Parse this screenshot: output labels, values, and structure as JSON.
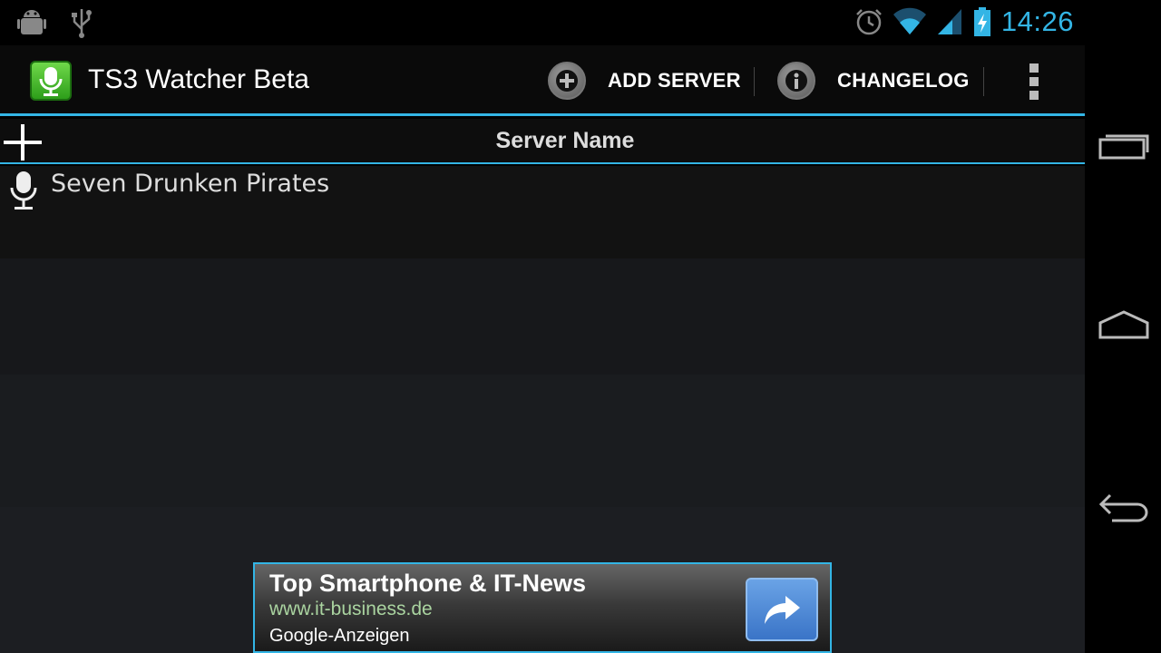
{
  "status_bar": {
    "time": "14:26",
    "left_icons": [
      "android-debug-icon",
      "usb-icon"
    ],
    "right_icons": [
      "alarm-icon",
      "wifi-icon",
      "signal-icon",
      "battery-charging-icon"
    ]
  },
  "action_bar": {
    "app_title": "TS3 Watcher Beta",
    "app_icon": "teamspeak-mic-icon",
    "add_server_label": "ADD SERVER",
    "changelog_label": "CHANGELOG",
    "overflow_icon": "overflow-menu-icon"
  },
  "list_header": {
    "title": "Server Name"
  },
  "servers": [
    {
      "name": "Seven Drunken Pirates",
      "icon": "microphone-icon"
    }
  ],
  "ad": {
    "title": "Top Smartphone & IT-News",
    "url": "www.it-business.de",
    "source": "Google-Anzeigen"
  },
  "nav_bar": [
    "recent-apps-icon",
    "home-icon",
    "back-icon"
  ],
  "colors": {
    "accent": "#33b5e5",
    "background": "#000000"
  }
}
